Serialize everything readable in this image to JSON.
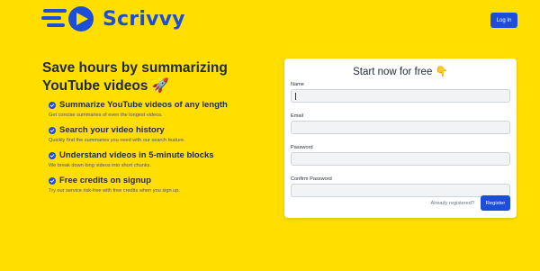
{
  "header": {
    "logo_text": "Scrivvy",
    "login_label": "Log In"
  },
  "hero": {
    "title": "Save hours by summarizing YouTube videos 🚀",
    "features": [
      {
        "title": "Summarize YouTube videos of any length",
        "desc": "Get concise summaries of even the longest videos.",
        "icon": "check-circle-icon"
      },
      {
        "title": "Search your video history",
        "desc": "Quickly find the summaries you need with our search feature.",
        "icon": "check-circle-icon"
      },
      {
        "title": "Understand videos in 5-minute blocks",
        "desc": "We break down long videos into short chunks.",
        "icon": "check-circle-icon"
      },
      {
        "title": "Free credits on signup",
        "desc": "Try our service risk-free with free credits when you sign up.",
        "icon": "check-circle-icon"
      }
    ]
  },
  "form": {
    "title": "Start now for free 👇",
    "name_label": "Name",
    "name_value": "",
    "email_label": "Email",
    "email_value": "",
    "password_label": "Password",
    "password_value": "",
    "confirm_label": "Confirm Password",
    "confirm_value": "",
    "already_label": "Already registered?",
    "register_label": "Register"
  },
  "colors": {
    "background": "#ffde00",
    "accent": "#1d4ed8",
    "card": "#ffffff",
    "input_bg": "#f1f3f5"
  }
}
